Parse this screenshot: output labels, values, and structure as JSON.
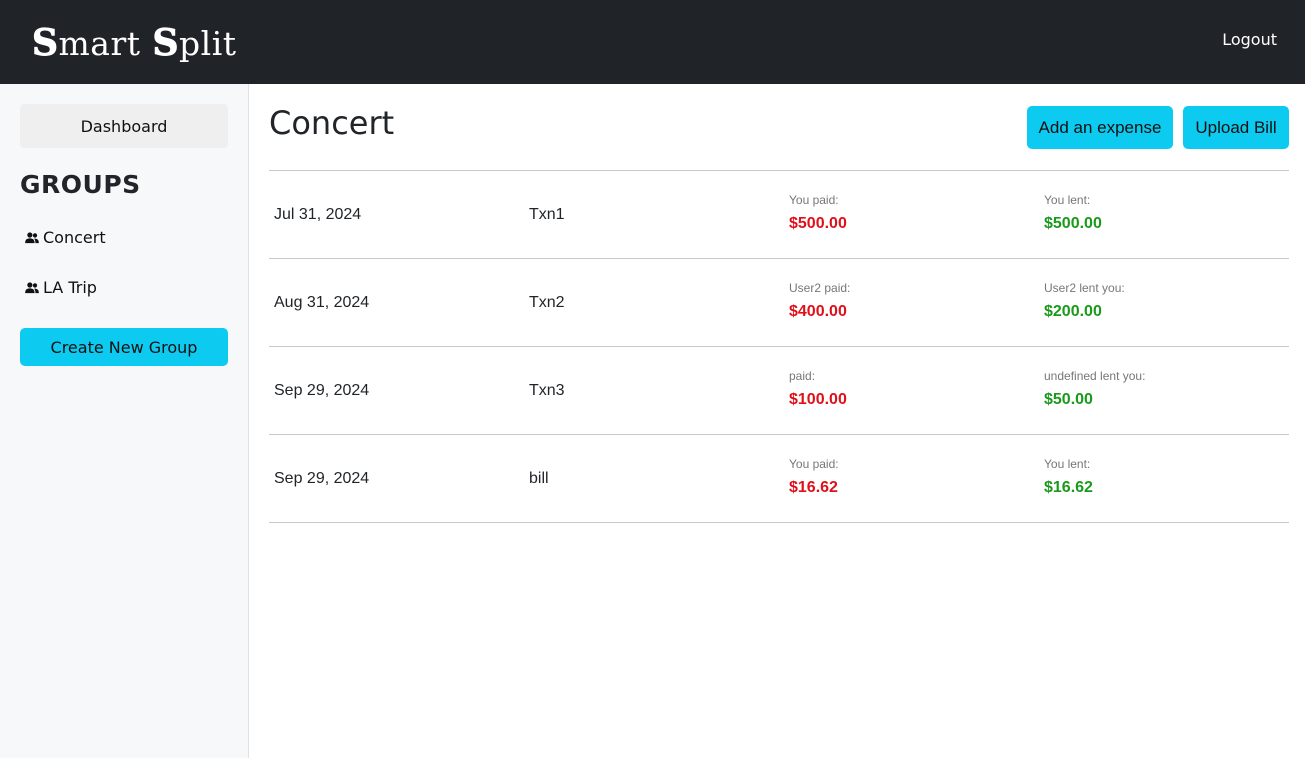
{
  "navbar": {
    "brand_part1_initial": "S",
    "brand_part1_rest": "mart",
    "brand_part2_initial": "S",
    "brand_part2_rest": "plit",
    "logout_label": "Logout"
  },
  "sidebar": {
    "dashboard_label": "Dashboard",
    "groups_title": "GROUPS",
    "groups": [
      {
        "label": "Concert",
        "icon": "people-icon"
      },
      {
        "label": "LA Trip",
        "icon": "people-icon"
      }
    ],
    "create_group_label": "Create New Group"
  },
  "main": {
    "title": "Concert",
    "add_expense_label": "Add an expense",
    "upload_bill_label": "Upload Bill",
    "transactions": [
      {
        "date": "Jul 31, 2024",
        "name": "Txn1",
        "paid_label": "You paid:",
        "paid_amount": "$500.00",
        "lent_label": "You lent:",
        "lent_amount": "$500.00"
      },
      {
        "date": "Aug 31, 2024",
        "name": "Txn2",
        "paid_label": "User2 paid:",
        "paid_amount": "$400.00",
        "lent_label": "User2 lent you:",
        "lent_amount": "$200.00"
      },
      {
        "date": "Sep 29, 2024",
        "name": "Txn3",
        "paid_label": "paid:",
        "paid_amount": "$100.00",
        "lent_label": "undefined lent you:",
        "lent_amount": "$50.00"
      },
      {
        "date": "Sep 29, 2024",
        "name": "bill",
        "paid_label": "You paid:",
        "paid_amount": "$16.62",
        "lent_label": "You lent:",
        "lent_amount": "$16.62"
      }
    ]
  },
  "colors": {
    "navbar_bg": "#202328",
    "accent": "#0dcaf0",
    "paid_red": "#e0101a",
    "lent_green": "#1a9a1a",
    "sidebar_bg": "#f7f8fa"
  }
}
